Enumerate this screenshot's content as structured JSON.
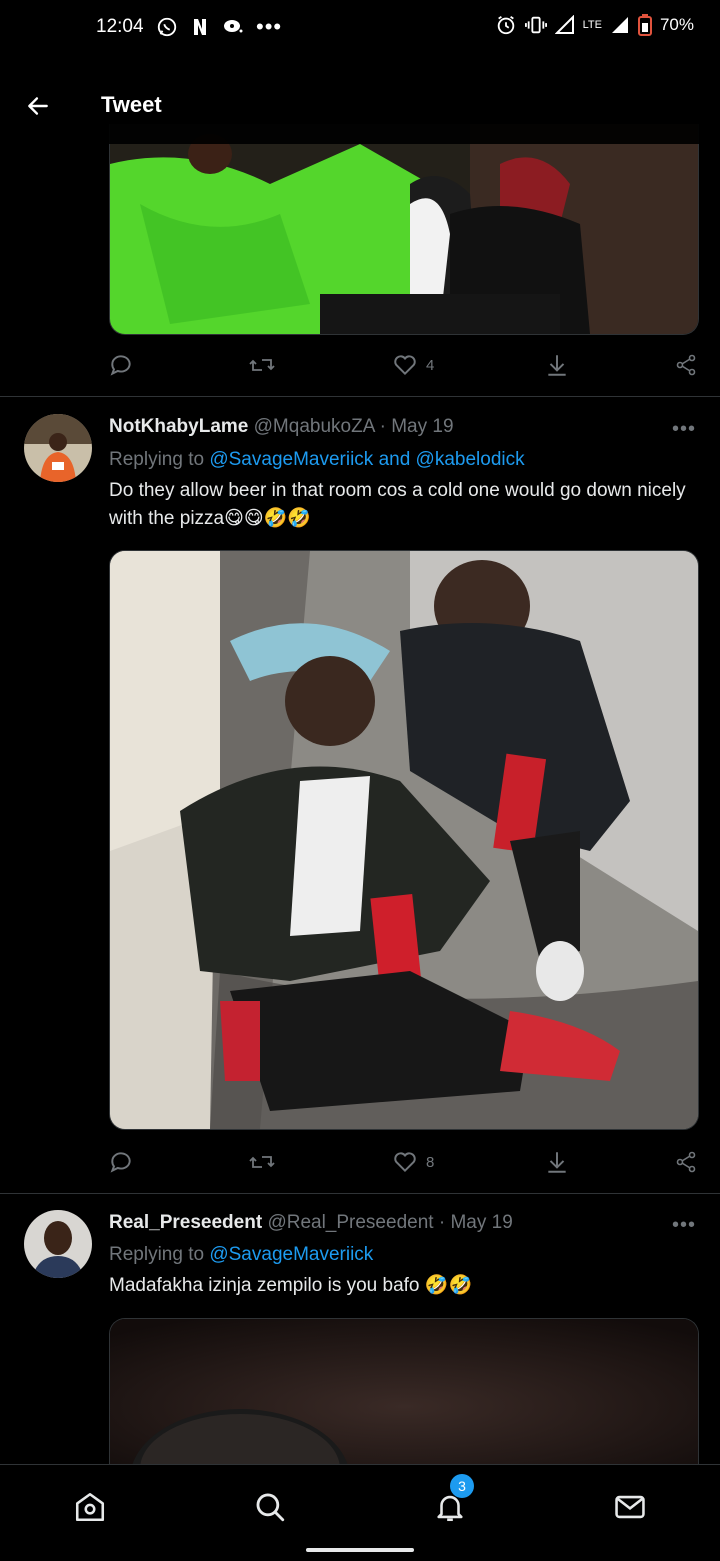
{
  "status_bar": {
    "time": "12:04",
    "battery": "70%",
    "network": "LTE"
  },
  "header": {
    "title": "Tweet"
  },
  "top_tweet_actions": {
    "likes": "4"
  },
  "tweets": [
    {
      "display_name": "NotKhabyLame",
      "handle": "@MqabukoZA",
      "date": "May 19",
      "separator": "·",
      "replying_label": "Replying to",
      "replying_to": "@SavageMaveriick and @kabelodick",
      "text": "Do they allow beer in that room cos a cold one would go down nicely with the pizza😋😋🤣🤣",
      "likes": "8"
    },
    {
      "display_name": "Real_Preseedent",
      "handle": "@Real_Preseedent",
      "date": "May 19",
      "separator": "·",
      "replying_label": "Replying to",
      "replying_to": "@SavageMaveriick",
      "text": "Madafakha izinja zempilo is you bafo 🤣🤣"
    }
  ],
  "bottom_nav": {
    "notifications_badge": "3"
  },
  "colors": {
    "background": "#000000",
    "accent": "#1d9bf0",
    "muted": "#71767b",
    "divider": "#2f3336"
  }
}
